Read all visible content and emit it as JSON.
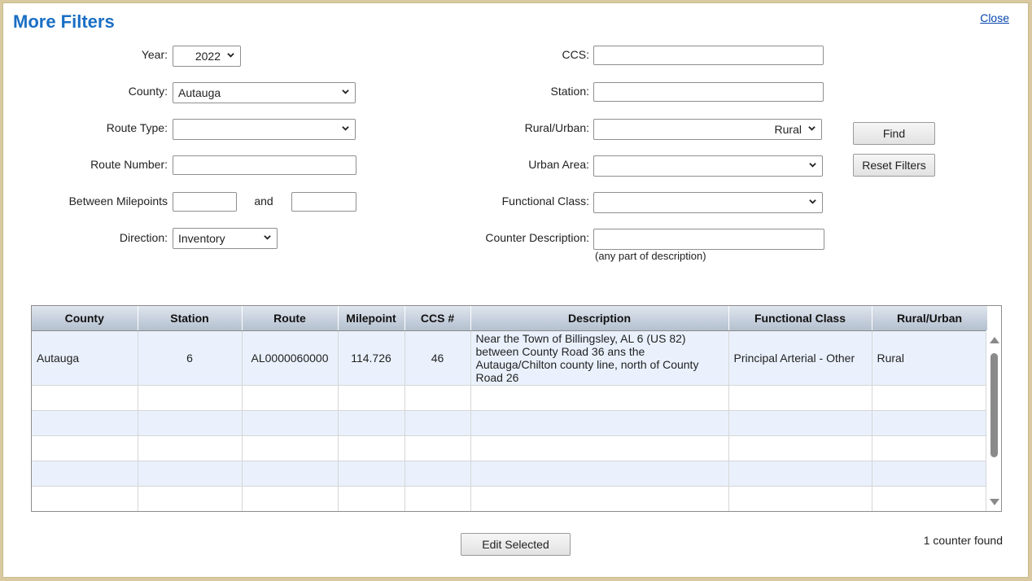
{
  "dialog": {
    "title": "More Filters",
    "close_label": "Close"
  },
  "filters": {
    "year": {
      "label": "Year:",
      "value": "2022"
    },
    "county": {
      "label": "County:",
      "value": "Autauga"
    },
    "route_type": {
      "label": "Route Type:",
      "value": ""
    },
    "route_number": {
      "label": "Route Number:",
      "value": ""
    },
    "between_milepoints": {
      "label": "Between Milepoints",
      "and_label": "and",
      "from": "",
      "to": ""
    },
    "direction": {
      "label": "Direction:",
      "value": "Inventory"
    },
    "ccs": {
      "label": "CCS:",
      "value": ""
    },
    "station": {
      "label": "Station:",
      "value": ""
    },
    "rural_urban": {
      "label": "Rural/Urban:",
      "value": "Rural"
    },
    "urban_area": {
      "label": "Urban Area:",
      "value": ""
    },
    "functional_class": {
      "label": "Functional Class:",
      "value": ""
    },
    "counter_description": {
      "label": "Counter Description:",
      "value": "",
      "hint": "(any part of description)"
    }
  },
  "buttons": {
    "find": "Find",
    "reset": "Reset Filters",
    "edit_selected": "Edit Selected"
  },
  "grid": {
    "columns": [
      "County",
      "Station",
      "Route",
      "Milepoint",
      "CCS #",
      "Description",
      "Functional Class",
      "Rural/Urban"
    ],
    "rows": [
      {
        "county": "Autauga",
        "station": "6",
        "route": "AL0000060000",
        "milepoint": "114.726",
        "ccs": "46",
        "description": "Near the Town of Billingsley, AL 6 (US 82) between County Road 36 ans the Autauga/Chilton county line, north of County Road 26",
        "functional_class": "Principal Arterial - Other",
        "rural_urban": "Rural"
      }
    ]
  },
  "status": {
    "count_text": "1 counter found"
  }
}
